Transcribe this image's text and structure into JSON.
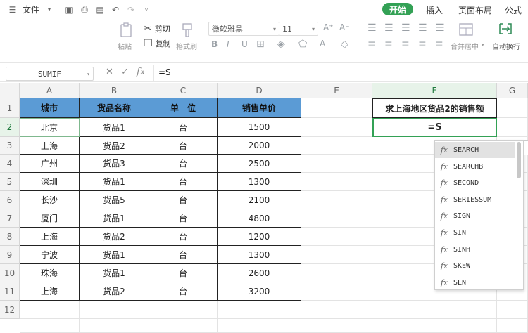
{
  "menubar": {
    "file_label": "文件",
    "tabs": [
      "开始",
      "插入",
      "页面布局",
      "公式"
    ]
  },
  "ribbon": {
    "paste": "粘贴",
    "cut": "剪切",
    "copy": "复制",
    "format_painter": "格式刷",
    "font_name": "微软雅黑",
    "font_size": "11",
    "merge_center": "合并居中",
    "wrap_text": "自动换行"
  },
  "formula_bar": {
    "name_box": "SUMIF",
    "formula": "=S"
  },
  "columns": [
    "A",
    "B",
    "C",
    "D",
    "E",
    "F",
    "G"
  ],
  "rows": [
    "1",
    "2",
    "3",
    "4",
    "5",
    "6",
    "7",
    "8",
    "9",
    "10",
    "11",
    "12"
  ],
  "table": {
    "headers": [
      "城市",
      "货品名称",
      "单　位",
      "销售单价"
    ],
    "rows": [
      [
        "北京",
        "货品1",
        "台",
        "1500"
      ],
      [
        "上海",
        "货品2",
        "台",
        "2000"
      ],
      [
        "广州",
        "货品3",
        "台",
        "2500"
      ],
      [
        "深圳",
        "货品1",
        "台",
        "1300"
      ],
      [
        "长沙",
        "货品5",
        "台",
        "2100"
      ],
      [
        "厦门",
        "货品1",
        "台",
        "4800"
      ],
      [
        "上海",
        "货品2",
        "台",
        "1200"
      ],
      [
        "宁波",
        "货品1",
        "台",
        "1300"
      ],
      [
        "珠海",
        "货品1",
        "台",
        "2600"
      ],
      [
        "上海",
        "货品2",
        "台",
        "3200"
      ]
    ]
  },
  "f_column": {
    "title": "求上海地区货品2的销售额",
    "edit_value": "=S"
  },
  "autocomplete": {
    "items": [
      "SEARCH",
      "SEARCHB",
      "SECOND",
      "SERIESSUM",
      "SIGN",
      "SIN",
      "SINH",
      "SKEW",
      "SLN"
    ],
    "highlighted": "SEARCH"
  },
  "colors": {
    "accent": "#33a155",
    "table_header": "#5b9bd5"
  }
}
